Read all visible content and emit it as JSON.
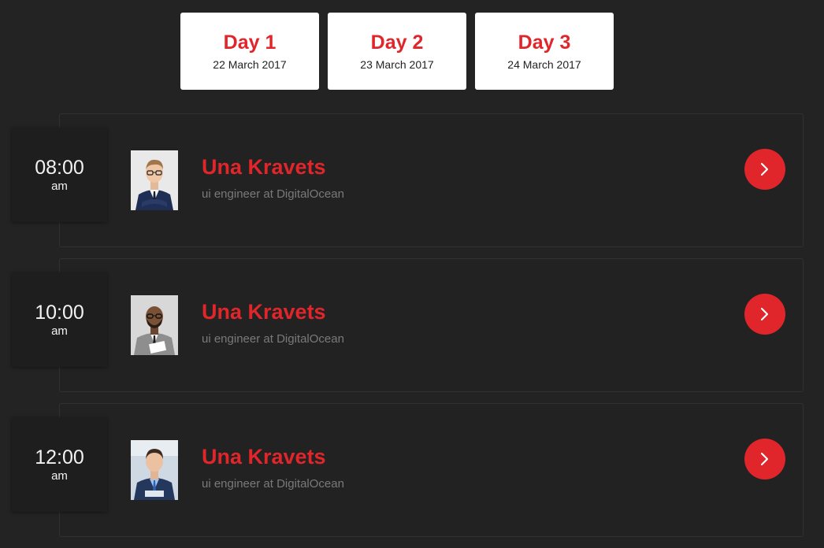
{
  "tabs": [
    {
      "title": "Day 1",
      "date": "22 March 2017"
    },
    {
      "title": "Day 2",
      "date": "23 March 2017"
    },
    {
      "title": "Day 3",
      "date": "24 March 2017"
    }
  ],
  "sessions": [
    {
      "time": "08:00",
      "period": "am",
      "name": "Una Kravets",
      "role": "ui engineer at DigitalOcean",
      "avatar_icon": "speaker-photo"
    },
    {
      "time": "10:00",
      "period": "am",
      "name": "Una Kravets",
      "role": "ui engineer at DigitalOcean",
      "avatar_icon": "speaker-photo"
    },
    {
      "time": "12:00",
      "period": "am",
      "name": "Una Kravets",
      "role": "ui engineer at DigitalOcean",
      "avatar_icon": "speaker-photo"
    }
  ],
  "colors": {
    "background": "#232323",
    "accent": "#e1262b",
    "card": "#222222",
    "time_box": "#1e1e1e",
    "role_text": "#7a7a7a"
  },
  "icons": {
    "next": "chevron-right-icon"
  }
}
